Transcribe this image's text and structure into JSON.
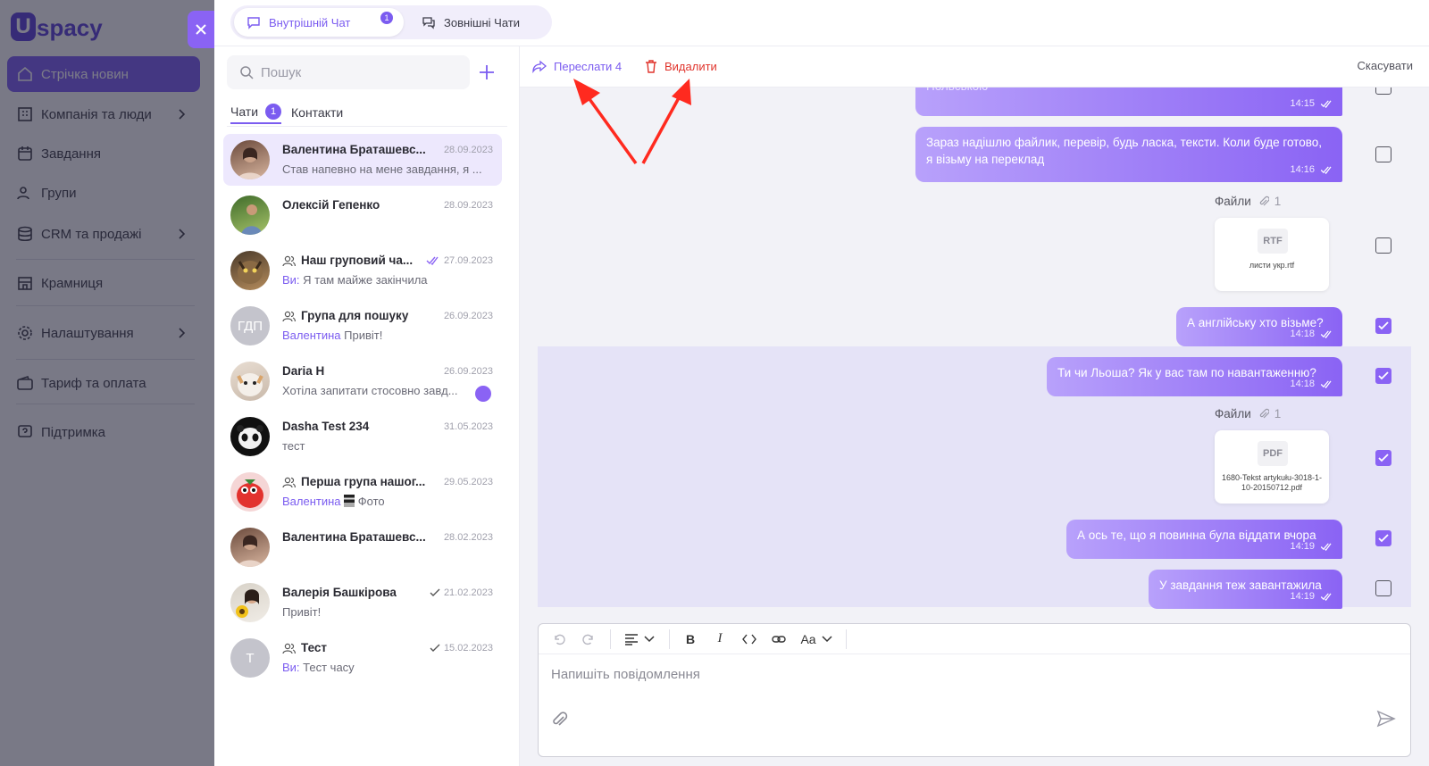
{
  "logo": {
    "letter": "U",
    "text": "spacy"
  },
  "nav": [
    {
      "label": "Стрічка новин",
      "icon": "home-icon",
      "active": true
    },
    {
      "label": "Компанія та люди",
      "icon": "building-icon",
      "chevron": true
    },
    {
      "label": "Завдання",
      "icon": "calendar-icon"
    },
    {
      "label": "Групи",
      "icon": "people-icon"
    },
    {
      "label": "CRM та продажі",
      "icon": "database-icon",
      "chevron": true
    },
    {
      "label": "Крамниця",
      "icon": "shop-icon"
    },
    {
      "label": "Налаштування",
      "icon": "gear-icon",
      "chevron": true
    },
    {
      "label": "Тариф та оплата",
      "icon": "wallet-icon"
    },
    {
      "label": "Підтримка",
      "icon": "help-icon"
    }
  ],
  "top_tabs": {
    "internal": {
      "label": "Внутрішній Чат",
      "badge": "1"
    },
    "external": {
      "label": "Зовнішні Чати"
    }
  },
  "search": {
    "placeholder": "Пошук"
  },
  "sub_tabs": {
    "chats": "Чати",
    "chats_badge": "1",
    "contacts": "Контакти"
  },
  "chats": [
    {
      "name": "Валентина Браташевс...",
      "date": "28.09.2023",
      "preview": "Став напевно на мене завдання, я ...",
      "who": "",
      "group": false,
      "check": "",
      "selected": true
    },
    {
      "name": "Олексій Гепенко",
      "date": "28.09.2023",
      "preview": "",
      "who": "",
      "group": false,
      "check": ""
    },
    {
      "name": "Наш груповий ча...",
      "date": "27.09.2023",
      "preview": "Я там майже закінчила",
      "who": "Ви:",
      "group": true,
      "check": "double"
    },
    {
      "name": "Група для пошуку",
      "date": "26.09.2023",
      "preview": "Привіт!",
      "who": "Валентина",
      "group": true,
      "check": "",
      "initials": "ГДП"
    },
    {
      "name": "Daria H",
      "date": "26.09.2023",
      "preview": "Хотіла запитати стосовно завд...",
      "who": "",
      "group": false,
      "check": "",
      "unread": true
    },
    {
      "name": "Dasha Test 234",
      "date": "31.05.2023",
      "preview": "тест",
      "who": "",
      "group": false,
      "check": ""
    },
    {
      "name": "Перша група нашог...",
      "date": "29.05.2023",
      "preview": "Фото",
      "who": "Валентина",
      "group": true,
      "check": ""
    },
    {
      "name": "Валентина Браташевс...",
      "date": "28.02.2023",
      "preview": "",
      "who": "",
      "group": false,
      "check": ""
    },
    {
      "name": "Валерія Башкірова",
      "date": "21.02.2023",
      "preview": "Привіт!",
      "who": "",
      "group": false,
      "check": "single"
    },
    {
      "name": "Тест",
      "date": "15.02.2023",
      "preview": "Тест часу",
      "who": "Ви:",
      "group": true,
      "check": "single",
      "initials": "Т"
    }
  ],
  "actions": {
    "forward": "Переслати 4",
    "delete": "Видалити",
    "cancel": "Скасувати"
  },
  "messages": [
    {
      "text": "Польською",
      "time": "14:15",
      "checked": false
    },
    {
      "text": "Зараз надішлю файлик, перевір, будь ласка, тексти. Коли буде готово, я візьму на переклад",
      "time": "14:16",
      "checked": false
    },
    {
      "files_label": "Файли",
      "files_count": "1",
      "ext": "RTF",
      "filename": "листи укр.rtf",
      "checked": false
    },
    {
      "text": "А англійську хто візьме?",
      "time": "14:18",
      "checked": true
    },
    {
      "text": "Ти чи Льоша? Як у вас там по навантаженню?",
      "time": "14:18",
      "checked": true
    },
    {
      "files_label": "Файли",
      "files_count": "1",
      "ext": "PDF",
      "filename": "1680-Tekst artykułu-3018-1-10-20150712.pdf",
      "checked": true
    },
    {
      "text": "А ось те, що я повинна була віддати вчора",
      "time": "14:19",
      "checked": true
    },
    {
      "text": "У завдання теж завантажила",
      "time": "14:19",
      "checked": false
    }
  ],
  "composer": {
    "placeholder": "Напишіть повідомлення",
    "font_label": "Aa"
  },
  "colors": {
    "accent": "#7b5cf0",
    "danger": "#e0342c",
    "arrow": "#ff2a1f"
  }
}
